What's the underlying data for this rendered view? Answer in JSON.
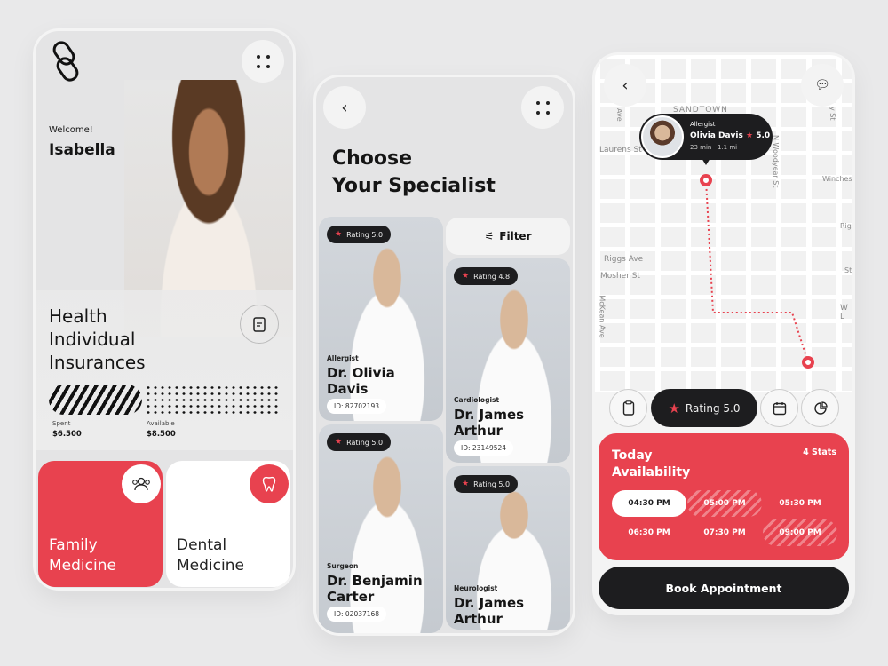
{
  "colors": {
    "accent": "#e8424f",
    "dark": "#1d1d1f",
    "background": "#e9e9ea"
  },
  "screen1": {
    "logo_icon": "pill-logo-icon",
    "welcome": "Welcome!",
    "user_name": "Isabella",
    "insurance_title_lines": [
      "Health",
      "Individual",
      "Insurances"
    ],
    "spent_label": "Spent",
    "spent_value": "$6.500",
    "available_label": "Available",
    "available_value": "$8.500",
    "tiles": [
      {
        "lines": [
          "Family",
          "Medicine"
        ],
        "icon": "users-icon"
      },
      {
        "lines": [
          "Dental",
          "Medicine"
        ],
        "icon": "tooth-icon"
      }
    ]
  },
  "screen2": {
    "title_lines": [
      "Choose",
      "Your Specialist"
    ],
    "filter_label": "Filter",
    "doctors": [
      {
        "rating": "Rating 5.0",
        "specialty": "Allergist",
        "name_lines": [
          "Dr. Olivia",
          "Davis"
        ],
        "id": "ID: 82702193"
      },
      {
        "rating": "Rating 4.8",
        "specialty": "Cardiologist",
        "name_lines": [
          "Dr. James",
          "Arthur"
        ],
        "id": "ID: 23149524"
      },
      {
        "rating": "Rating 5.0",
        "specialty": "Surgeon",
        "name_lines": [
          "Dr. Benjamin",
          "Carter"
        ],
        "id": "ID: 02037168"
      },
      {
        "rating": "Rating 5.0",
        "specialty": "Neurologist",
        "name_lines": [
          "Dr. James",
          "Arthur"
        ]
      }
    ]
  },
  "screen3": {
    "map": {
      "streets": [
        "SANDTOWN",
        "Laurens St",
        "Riggs Ave",
        "Mosher St",
        "McKean Ave",
        "N Woodyear St",
        "Winches",
        "Ave",
        "y St",
        "Rigg",
        "St",
        "W L"
      ]
    },
    "popup": {
      "specialty": "Allergist",
      "name": "Olivia Davis",
      "rating": "5.0",
      "eta": "23 min · 1.1 mi"
    },
    "rating_chip": "Rating 5.0",
    "availability_title_lines": [
      "Today",
      "Availability"
    ],
    "stats": "4 Stats",
    "slots": [
      {
        "time": "04:30 PM",
        "state": "selected"
      },
      {
        "time": "05:00 PM",
        "state": "unavailable"
      },
      {
        "time": "05:30 PM",
        "state": "available"
      },
      {
        "time": "06:30 PM",
        "state": "available"
      },
      {
        "time": "07:30 PM",
        "state": "available"
      },
      {
        "time": "09:00 PM",
        "state": "unavailable"
      }
    ],
    "book_label": "Book Appointment"
  }
}
